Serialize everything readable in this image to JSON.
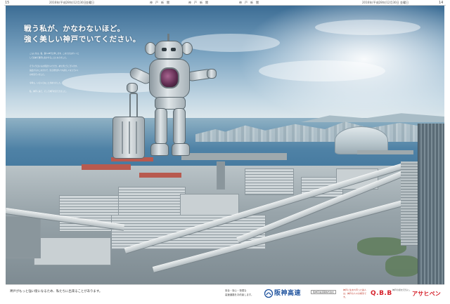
{
  "newspaper_header": {
    "left_page_number": "15",
    "left_date": "2016年(平成28年)12月30日",
    "left_paper": "金曜日",
    "center_paper_1": "神　戸　新　聞",
    "center_paper_2": "神　戸　新　聞",
    "center_paper_3": "神　戸　新　聞",
    "right_date": "2016年(平成28年)12月30日",
    "right_paper": "金曜日",
    "right_page_number": "14"
  },
  "ad": {
    "headline_line1": "戦う私が、かなわないほど。",
    "headline_line2": "強く美しい神戸でいてください。",
    "body_paragraphs": [
      "こんにちは。私、鉄人28号と申します。このたびロボットとして初めて旅行に出かけることになりました。",
      "そういう日にもお見送りいただき、ありがとうございます。長田からのこのまちで、見る景色がいつも新しくなっていくのを見ていました。",
      "今年も、いろいろなことがありました。",
      "私、神戸に来て、そして神戸を見てきました。"
    ],
    "footer_copy": "神戸がもっと強い街になるため、私たちに出来ることがあります。",
    "footer_tagline_line1": "安全・安心・快適な",
    "footer_tagline_line2": "高速道路をお約束します。",
    "brand_name": "阪神高速",
    "brand_sub": "阪神高速道路株式会社",
    "sponsor_note_1": "神戸に生まれ育った鉄人は、神戸の人々の希望です。",
    "sponsor_name_1": "Q.B.B",
    "sponsor_note_2": "神戸の街を元気に。",
    "sponsor_name_2": "アサヒペン"
  },
  "colors": {
    "headline": "#ffffff",
    "brand": "#1a4f9c",
    "sponsor_red": "#d6202a"
  }
}
